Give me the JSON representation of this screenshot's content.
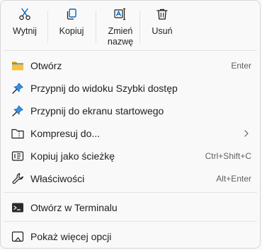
{
  "toolbar": {
    "cut_label": "Wytnij",
    "copy_label": "Kopiuj",
    "rename_label_line1": "Zmień",
    "rename_label_line2": "nazwę",
    "delete_label": "Usuń"
  },
  "items": [
    {
      "label": "Otwórz",
      "shortcut": "Enter",
      "icon": "folder-icon"
    },
    {
      "label": "Przypnij do widoku Szybki dostęp",
      "shortcut": "",
      "icon": "pin-icon"
    },
    {
      "label": "Przypnij do ekranu startowego",
      "shortcut": "",
      "icon": "pin-icon"
    },
    {
      "label": "Kompresuj do...",
      "shortcut": "",
      "icon": "archive-folder-icon",
      "submenu": true
    },
    {
      "label": "Kopiuj jako ścieżkę",
      "shortcut": "Ctrl+Shift+C",
      "icon": "copy-path-icon"
    },
    {
      "label": "Właściwości",
      "shortcut": "Alt+Enter",
      "icon": "wrench-icon"
    },
    {
      "label": "Otwórz w Terminalu",
      "shortcut": "",
      "icon": "terminal-icon"
    },
    {
      "label": "Pokaż więcej opcji",
      "shortcut": "",
      "icon": "more-options-icon"
    }
  ],
  "colors": {
    "accent": "#0067c0",
    "folder": "#f5c242",
    "background": "#f9f9f9",
    "separator": "#e3e3e3"
  }
}
